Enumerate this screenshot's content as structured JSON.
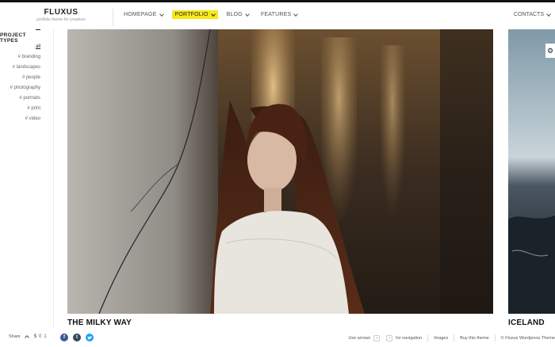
{
  "brand": {
    "title": "FLUXUS",
    "tagline": "portfolio theme for creatives"
  },
  "nav": {
    "items": [
      {
        "label": "HOMEPAGE",
        "active": false
      },
      {
        "label": "PORTFOLIO",
        "active": true
      },
      {
        "label": "BLOG",
        "active": false
      },
      {
        "label": "FEATURES",
        "active": false
      }
    ],
    "contacts": "CONTACTS"
  },
  "sidebar": {
    "heading": "PROJECT TYPES",
    "items": [
      "all",
      "# branding",
      "# landscapes",
      "# people",
      "# photography",
      "# portraits",
      "# print",
      "# video"
    ],
    "current": "all"
  },
  "gallery": {
    "current_caption": "THE MILKY WAY",
    "next_caption": "ICELAND"
  },
  "footer": {
    "share_label": "Share",
    "share_counts": [
      "$",
      "0",
      "1"
    ],
    "social": [
      "f",
      "t",
      "t"
    ],
    "use_arrows": "Use arrows",
    "for_navigation": "for navigation",
    "images_label": "Images",
    "buy_label": "Buy this theme",
    "copyright": "© Fluxus Wordpress Theme"
  },
  "colors": {
    "accent": "#f7e819",
    "text": "#222222"
  },
  "icons": {
    "settings": "gear-icon",
    "dropdown": "chevron-down-icon"
  }
}
